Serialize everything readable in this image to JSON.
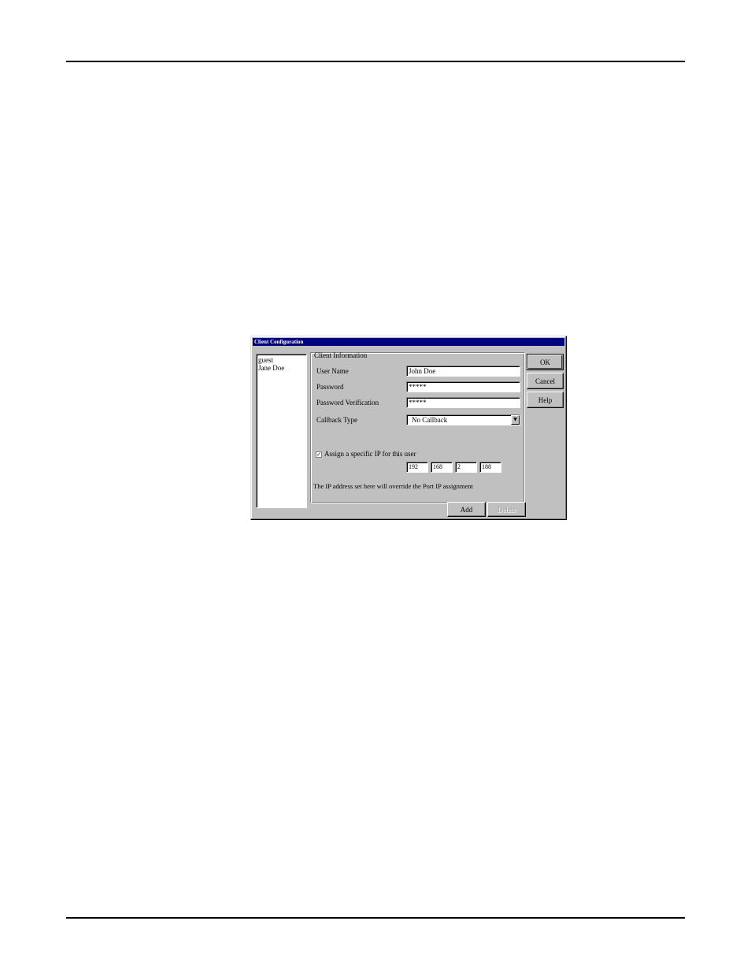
{
  "dialog": {
    "title": "Client Configuration",
    "user_list": [
      "guest",
      "Jane Doe"
    ],
    "group_label": "Client Information",
    "fields": {
      "user_name": {
        "label": "User Name",
        "value": "John Doe"
      },
      "password": {
        "label": "Password",
        "value": "*****"
      },
      "password_verification": {
        "label": "Password Verification",
        "value": "*****"
      },
      "callback_type": {
        "label": "Callback Type",
        "value": "No Callback"
      }
    },
    "assign_ip": {
      "label": "Assign a specific IP for this user",
      "checked": true,
      "octets": [
        "192",
        "168",
        "2",
        "188"
      ]
    },
    "note": "The IP address set here will override the Port IP assignment",
    "buttons": {
      "ok": "OK",
      "cancel": "Cancel",
      "help": "Help",
      "add": "Add",
      "delete": "Delete"
    }
  }
}
